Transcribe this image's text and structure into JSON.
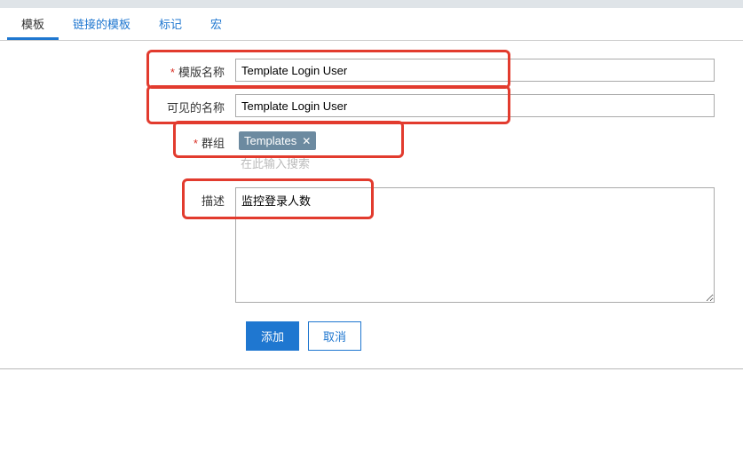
{
  "tabs": {
    "template": "模板",
    "linked_templates": "链接的模板",
    "tags": "标记",
    "macros": "宏"
  },
  "form": {
    "template_name_label": "模版名称",
    "template_name_value": "Template Login User",
    "visible_name_label": "可见的名称",
    "visible_name_value": "Template Login User",
    "groups_label": "群组",
    "groups_tag": "Templates",
    "groups_search_placeholder": "在此输入搜索",
    "description_label": "描述",
    "description_value": "监控登录人数"
  },
  "buttons": {
    "add": "添加",
    "cancel": "取消"
  }
}
